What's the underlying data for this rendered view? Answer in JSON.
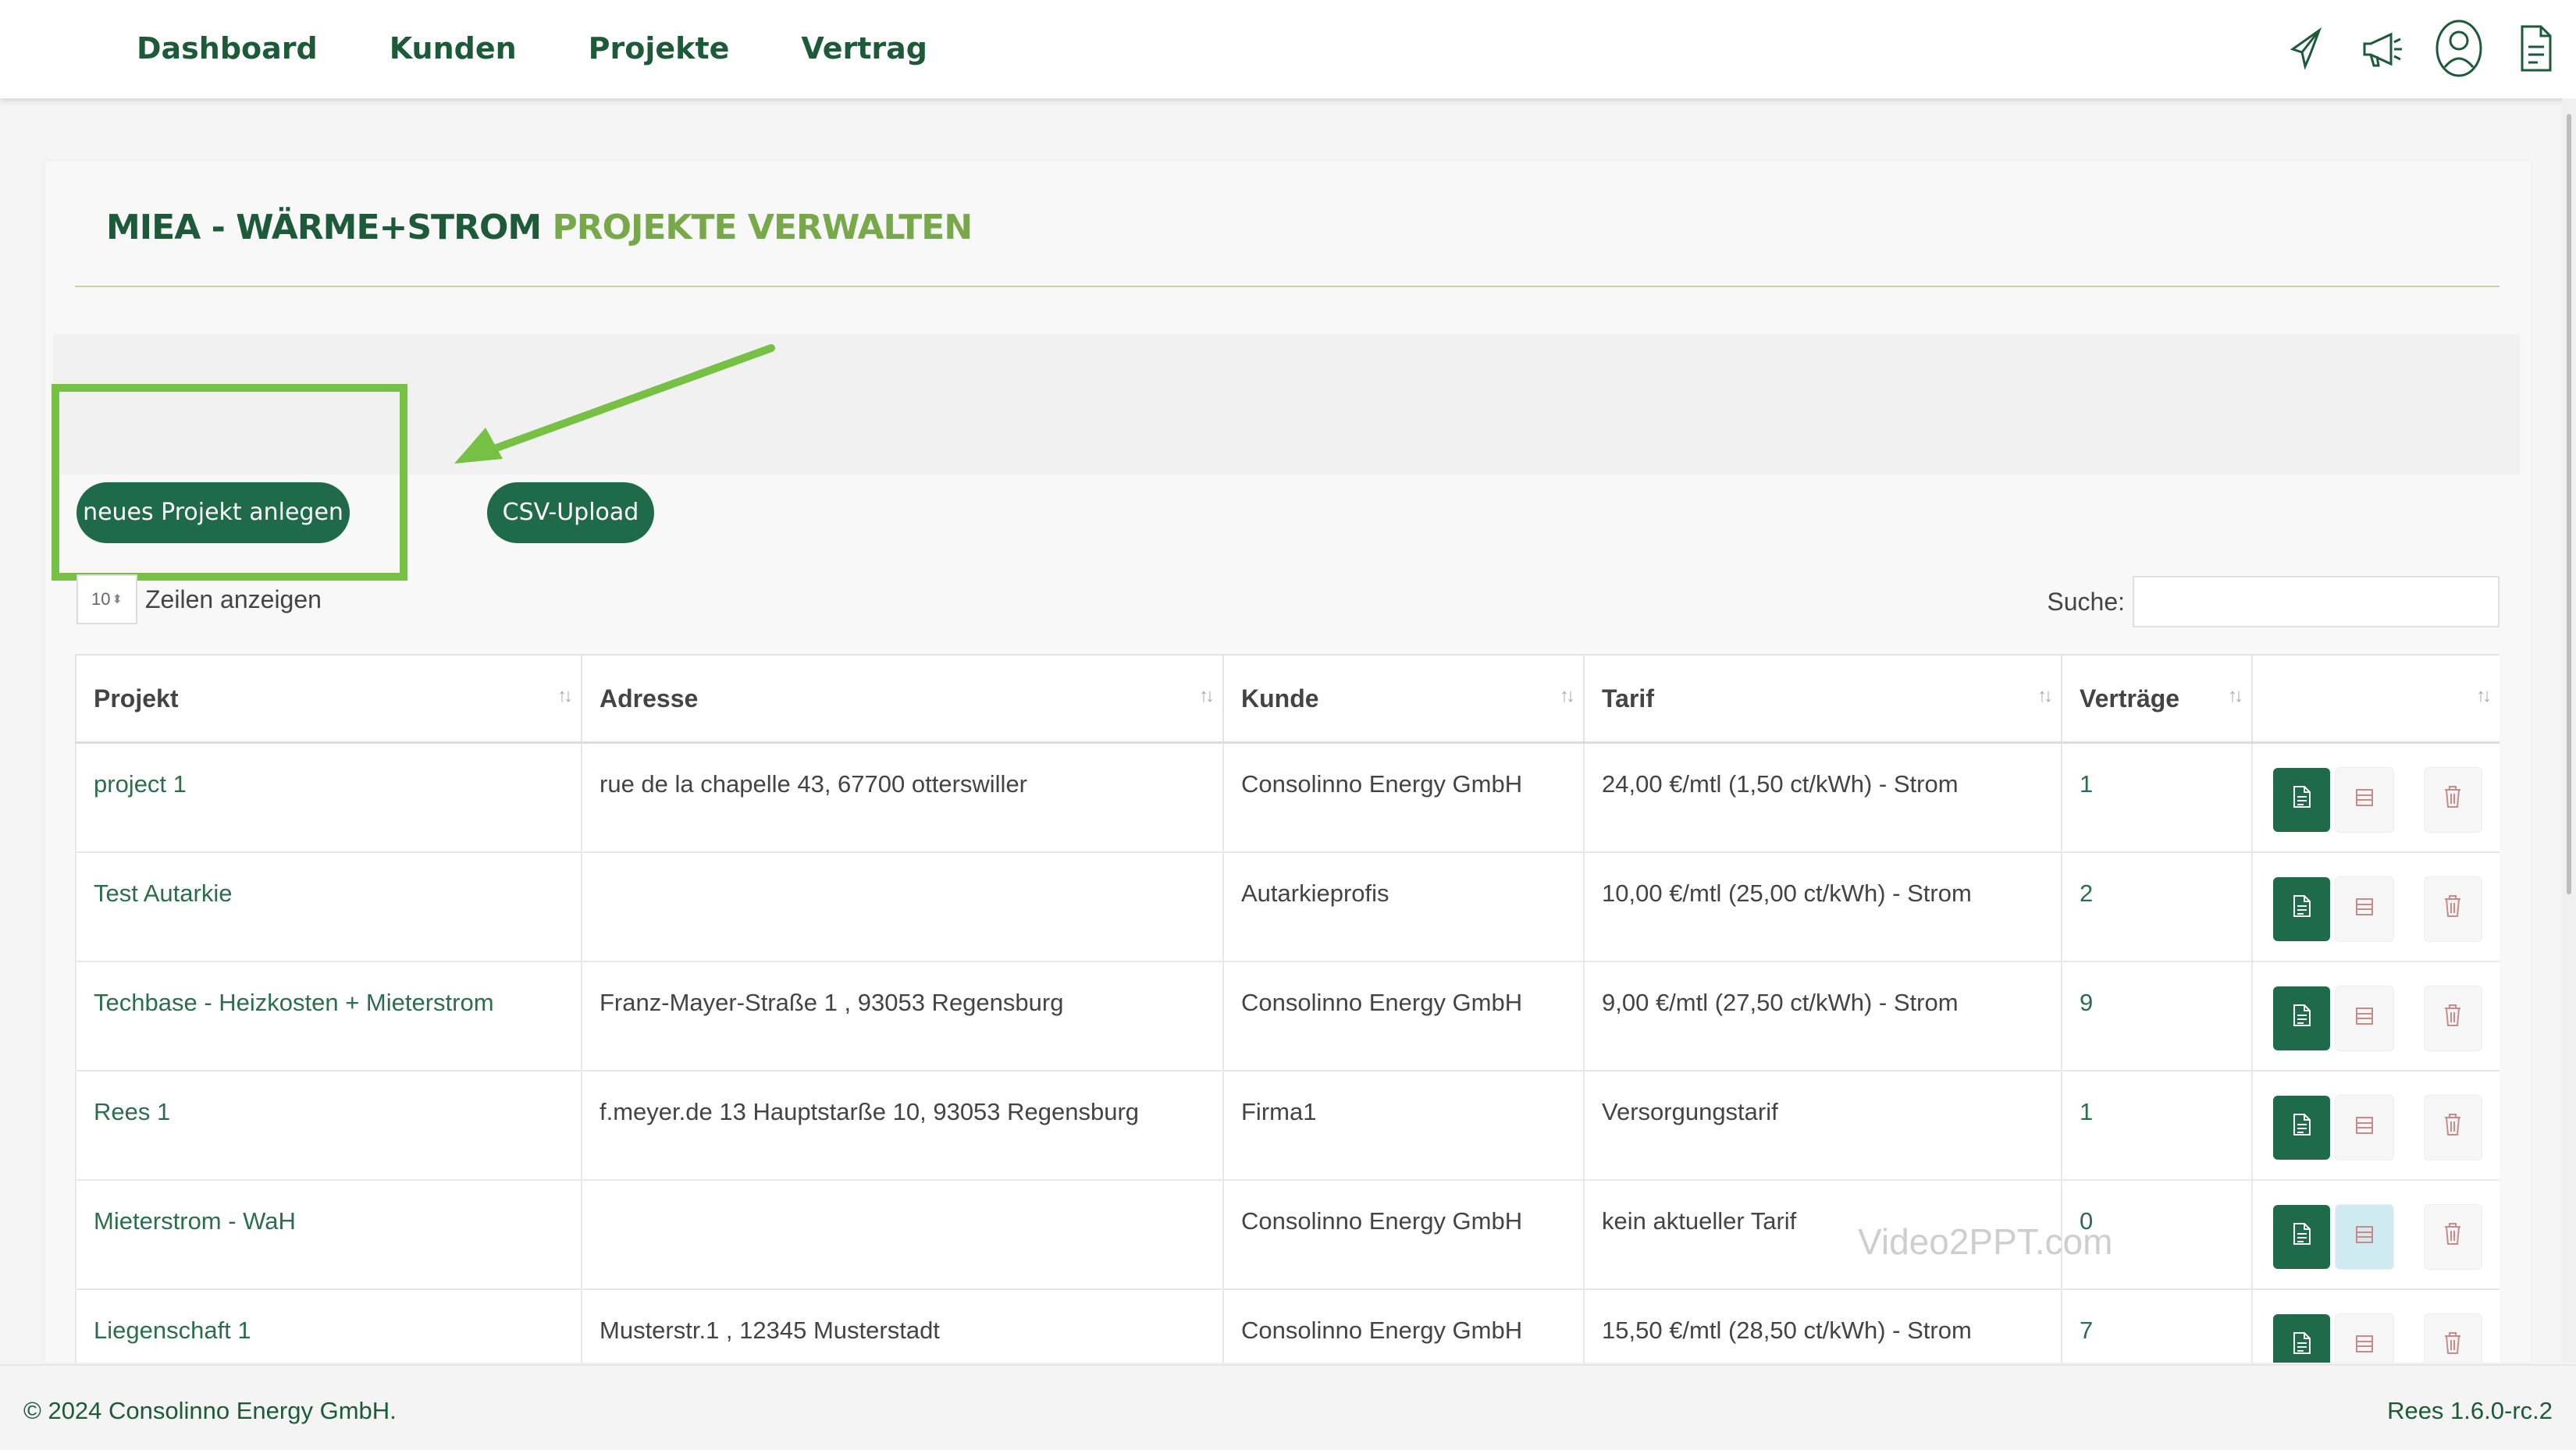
{
  "nav": {
    "items": [
      "Dashboard",
      "Kunden",
      "Projekte",
      "Vertrag"
    ],
    "icons": [
      "paper-plane-icon",
      "megaphone-icon",
      "user-icon",
      "document-icon"
    ]
  },
  "page": {
    "title_part1": "MIEA - WÄRME+STROM",
    "title_part2": "PROJEKTE VERWALTEN"
  },
  "buttons": {
    "new_project": "neues Projekt anlegen",
    "csv_upload": "CSV-Upload"
  },
  "table_controls": {
    "page_length": "10",
    "length_label": "Zeilen anzeigen",
    "search_label": "Suche:",
    "search_value": ""
  },
  "table": {
    "headers": [
      "Projekt",
      "Adresse",
      "Kunde",
      "Tarif",
      "Verträge",
      ""
    ],
    "rows": [
      {
        "projekt": "project 1",
        "adresse": "rue de la chapelle 43, 67700 otterswiller",
        "kunde": "Consolinno Energy GmbH",
        "tarif": "24,00 €/mtl (1,50 ct/kWh) - Strom",
        "vertraege": "1"
      },
      {
        "projekt": "Test Autarkie",
        "adresse": "",
        "kunde": "Autarkieprofis",
        "tarif": "10,00 €/mtl (25,00 ct/kWh) - Strom",
        "vertraege": "2"
      },
      {
        "projekt": "Techbase - Heizkosten + Mieterstrom",
        "adresse": "Franz-Mayer-Straße 1 , 93053 Regensburg",
        "kunde": "Consolinno Energy GmbH",
        "tarif": "9,00 €/mtl (27,50 ct/kWh) - Strom",
        "vertraege": "9"
      },
      {
        "projekt": "Rees 1",
        "adresse": "f.meyer.de 13 Hauptstarße 10, 93053 Regensburg",
        "kunde": "Firma1",
        "tarif": "Versorgungstarif",
        "vertraege": "1"
      },
      {
        "projekt": "Mieterstrom - WaH",
        "adresse": "",
        "kunde": "Consolinno Energy GmbH",
        "tarif": "kein aktueller Tarif",
        "vertraege": "0"
      },
      {
        "projekt": "Liegenschaft 1",
        "adresse": "Musterstr.1 , 12345 Musterstadt",
        "kunde": "Consolinno Energy GmbH",
        "tarif": "15,50 €/mtl (28,50 ct/kWh) - Strom",
        "vertraege": "7"
      }
    ]
  },
  "watermark": "Video2PPT.com",
  "footer": {
    "copyright": "© 2024 Consolinno Energy GmbH.",
    "version": "Rees 1.6.0-rc.2"
  },
  "colors": {
    "brand_dark": "#1d5a3a",
    "brand_light": "#77a84a",
    "button": "#1f6b49",
    "highlight": "#76c043",
    "delete_icon": "#c98a8a"
  }
}
